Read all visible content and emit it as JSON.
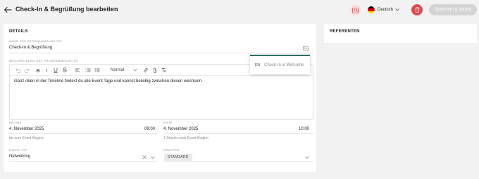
{
  "header": {
    "title": "Check-In & Begrüßung bearbeiten",
    "language": "Deutsch",
    "save_label": "Speichern & zurück"
  },
  "details": {
    "title": "DETAILS",
    "name": {
      "label": "NAME DES PROGRAMMPUNKTES",
      "value": "Check-In & Begrüßung"
    },
    "description": {
      "label": "BESCHREIBUNG DES PROGRAMMPUNKTES",
      "format_option": "Normal",
      "content": "Ganz oben in der Timeline findest du alle Event Tage und kannst beliebig zwischen diesen wechseln."
    },
    "translation_popup": {
      "lang": "EN",
      "value": "Check-In & Welcome"
    },
    "start": {
      "label": "BEGINN",
      "date": "4. November 2025",
      "time": "09:00",
      "hint": "bis zum Event-Beginn"
    },
    "end": {
      "label": "ENDE",
      "date": "4. November 2025",
      "time": "10:00",
      "hint": "1 Stunde nach Event-Beginn"
    },
    "event_type": {
      "label": "EVENT-TYP",
      "value": "Networking"
    },
    "groups": {
      "label": "GRUPPEN",
      "chip": "STANDARD"
    }
  },
  "referents": {
    "title": "REFERENTEN"
  },
  "colors": {
    "accent_red": "#e0494f",
    "teal": "#2c6f6b",
    "muted": "#8a8a8a"
  }
}
